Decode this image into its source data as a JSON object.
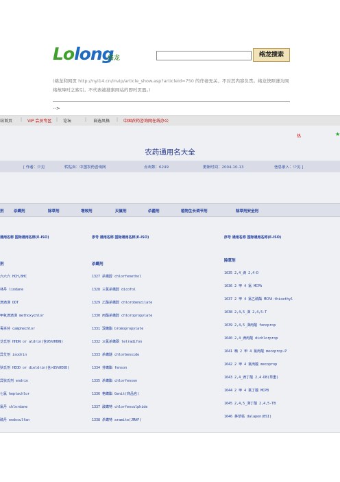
{
  "header": {
    "logo_text_1": "Lo",
    "logo_text_2": "long",
    "logo_cn": "络龙",
    "search_button": "络龙搜索",
    "notice": "(络龙和网页 http://nyi14.cn/invip/article_show.asp?articleid=750 的作者无关，不对其内容负责。络龙快照谨为网络故障时之索引，不代表被搜索网站的即时页面。)",
    "arrow": "-->"
  },
  "nav": [
    {
      "label": "站首页",
      "color": "#444444"
    },
    {
      "label": "|",
      "color": "#999999"
    },
    {
      "label": "VIP 会员专区",
      "color": "#c01010"
    },
    {
      "label": "|",
      "color": "#999999"
    },
    {
      "label": "论坛",
      "color": "#444444"
    },
    {
      "label": "|",
      "color": "#999999"
    },
    {
      "label": "自选风格",
      "color": "#444444"
    },
    {
      "label": "|",
      "color": "#999999"
    },
    {
      "label": "中国农药咨询网在线办公",
      "color": "#c01010"
    }
  ],
  "article": {
    "hot": "热",
    "star": "★",
    "title": "农药通用名大全",
    "info": [
      "[ 作者：少见",
      "转贴自：中国农药咨询网",
      "点击数：6249",
      "更新时间：2004-10-13",
      "信息录入：少见 ]"
    ]
  },
  "categories": [
    "剂",
    "杀螨剂",
    "除草剂",
    "增效剂",
    "灭鼠剂",
    "杀菌剂",
    "植物生长调节剂",
    "除草剂安全剂"
  ],
  "columns": [
    {
      "header": "通用名称 国际通用名称(E-ISO)",
      "section": "剂",
      "rows": [
        "六六六 HCH,BHC",
        "林丹 lindane",
        "滴滴涕 DDT",
        "甲氧滴滴涕 methoxychlor",
        "毒杀芬 camphechlor",
        "艾氏剂 HHDN or aldrin(含95%HHDN)",
        "异艾剂 isodrin",
        "狄氏剂 HEOD or dieldrin(含>85%HEOD)",
        "异狄氏剂 endrin",
        "七氯 heptachlor",
        "氯丹 chlordane",
        "硫丹 endosulfan"
      ]
    },
    {
      "header": "序号 通用名称 国际通用名称(E-ISO)",
      "section": "杀螨剂",
      "rows": [
        "1327 杀螨醇 chlorfenethol",
        "1328 三氯杀螨醇 dicofol",
        "1329 乙酯杀螨醇 chlorobenzilate",
        "1330 丙酯杀螨醇 chloropropylate",
        "1331 溴螨酯 bromopropylate",
        "1332 三氯杀螨砜 tetradifon",
        "1333 杀螨醚 chlorbenside",
        "1334 芬螨酯 fenson",
        "1335 杀螨酯 chlorfenson",
        "1336 格螨酯 Genit(商品名)",
        "1337 敌螨特 chlorfensulphide",
        "1338 杀螨特 aramite(JMAF)"
      ]
    },
    {
      "header": "序号 通用名称 国际通用名称(E-ISO)",
      "section": "除草剂",
      "rows": [
        "1635 2,4_滴 2,4-D",
        "1636 2 甲 4 氯 MCPA",
        "1637 2 甲 4 氯乙硫酯 MCPA-thioethyl",
        "1638 2,4,5_涕 2,4,5-T",
        "1639 2,4,5_涕丙酸 fenoprop",
        "1640 2,4_滴丙酸 dichlorprop",
        "1641 精 2 甲 4 氯丙酸 mecoprop-P",
        "1642 2 甲 4 氯丙酸 mecoprop",
        "1643 2,4_滴丁酸 2,4-DB(草重)",
        "1644 2 甲 4 氯丁酸 MCPB",
        "1645 2,4,5_涕丁酸 2,4,5-TB",
        "1646 茅草枯 dalapon(BSI)"
      ]
    }
  ]
}
